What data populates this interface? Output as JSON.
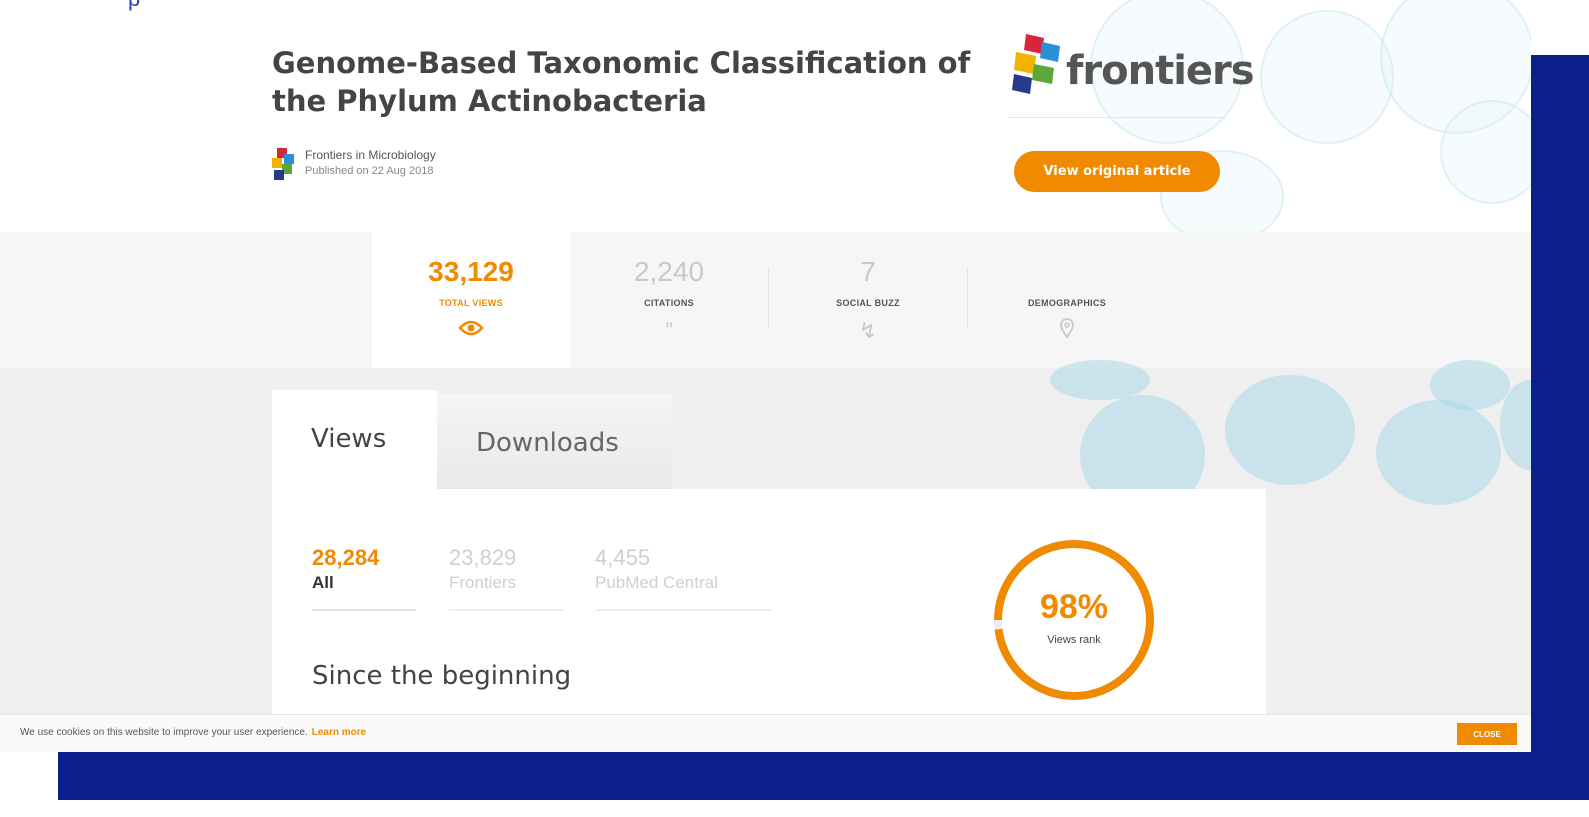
{
  "article": {
    "title": "Genome-Based Taxonomic Classification of the Phylum Actinobacteria",
    "journal": "Frontiers in Microbiology",
    "published": "Published on 22 Aug 2018"
  },
  "brand": {
    "wordmark": "frontiers",
    "view_original_label": "View original article",
    "accent_color": "#f08a00",
    "frame_color": "#0b1f8a"
  },
  "metrics": [
    {
      "value": "33,129",
      "label": "TOTAL VIEWS",
      "icon": "eye-icon",
      "active": true
    },
    {
      "value": "2,240",
      "label": "CITATIONS",
      "icon": "quote-icon",
      "active": false
    },
    {
      "value": "7",
      "label": "SOCIAL BUZZ",
      "icon": "lightning-icon",
      "active": false
    },
    {
      "value": "",
      "label": "DEMOGRAPHICS",
      "icon": "map-pin-icon",
      "active": false
    }
  ],
  "tabs": {
    "views_label": "Views",
    "downloads_label": "Downloads"
  },
  "views_panel": {
    "breakdown": [
      {
        "value": "28,284",
        "label": "All",
        "active": true
      },
      {
        "value": "23,829",
        "label": "Frontiers",
        "active": false
      },
      {
        "value": "4,455",
        "label": "PubMed Central",
        "active": false
      }
    ],
    "period_title": "Since the beginning",
    "rank_value": "98%",
    "rank_label": "Views rank",
    "rank_fraction": 0.98
  },
  "cookie": {
    "text": "We use cookies on this website to improve your user experience.",
    "link": "Learn more",
    "close_label": "CLOSE"
  }
}
